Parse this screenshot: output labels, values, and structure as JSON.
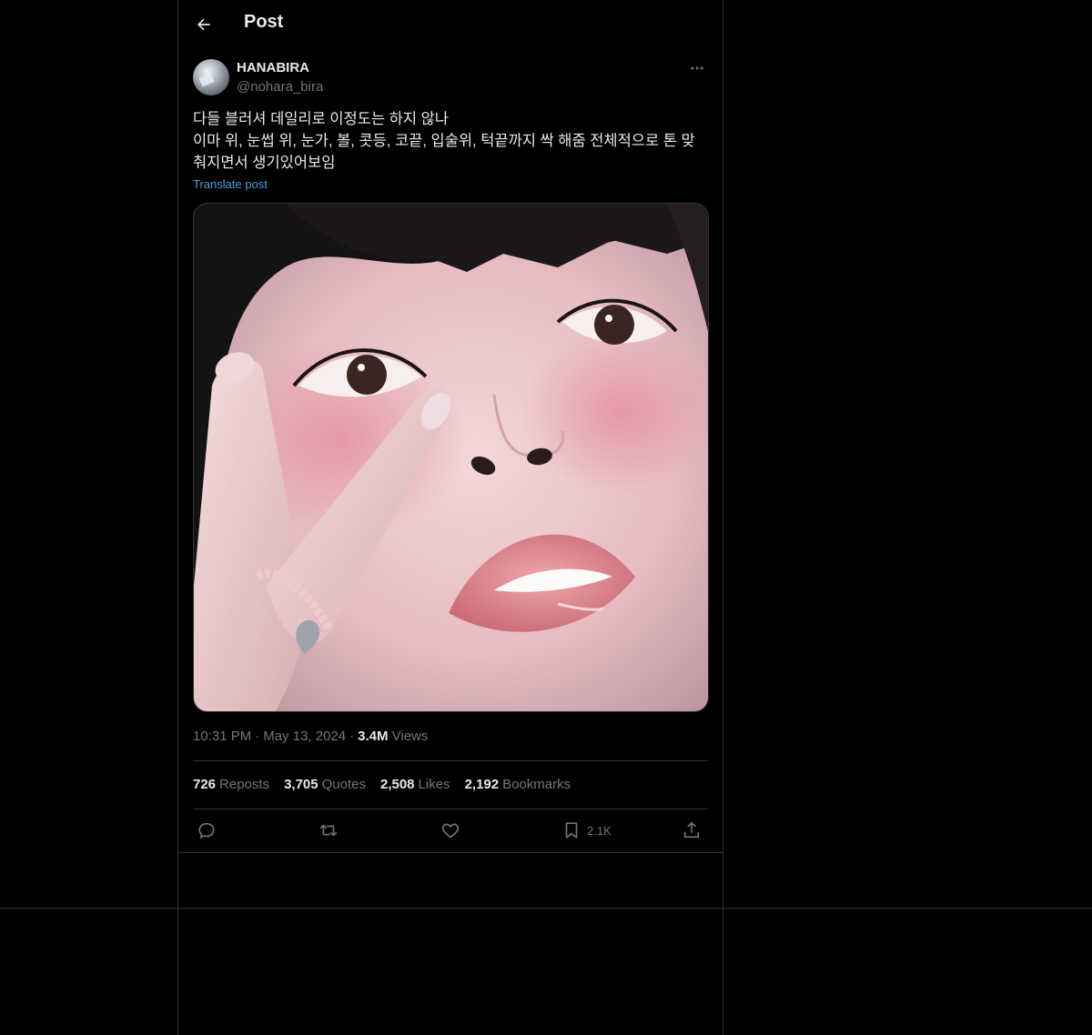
{
  "header": {
    "back_icon": "arrow-left-icon",
    "title": "Post"
  },
  "author": {
    "name": "HANABIRA",
    "handle": "@nohara_bira"
  },
  "post": {
    "text_lines": [
      "다들 블러셔 데일리로 이정도는 하지 않나",
      "이마 위, 눈썹 위, 눈가, 볼, 콧등, 코끝, 입술위, 턱끝까지 싹 해줌 전체적으로 톤 맞",
      "춰지면서 생기있어보임"
    ],
    "translate_label": "Translate post",
    "time": "10:31 PM",
    "date": "May 13, 2024",
    "views_count": "3.4M",
    "views_label": "Views"
  },
  "stats": {
    "reposts_count": "726",
    "reposts_label": "Reposts",
    "quotes_count": "3,705",
    "quotes_label": "Quotes",
    "likes_count": "2,508",
    "likes_label": "Likes",
    "bookmarks_count": "2,192",
    "bookmarks_label": "Bookmarks"
  },
  "actions": {
    "reply_icon": "reply-icon",
    "repost_icon": "repost-icon",
    "like_icon": "heart-icon",
    "bookmark_icon": "bookmark-icon",
    "bookmark_count": "2.1K",
    "share_icon": "share-icon"
  },
  "colors": {
    "background": "#000000",
    "text_primary": "#e7e9ea",
    "text_secondary": "#71767b",
    "link": "#4d9de0",
    "border": "#2f3336"
  }
}
